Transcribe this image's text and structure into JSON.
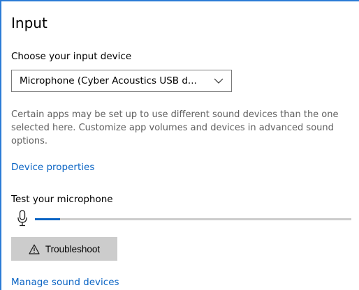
{
  "section": {
    "title": "Input",
    "choose_label": "Choose your input device",
    "device_dropdown": {
      "selected": "Microphone (Cyber Acoustics USB d..."
    },
    "description": "Certain apps may be set up to use different sound devices than the one\nselected here. Customize app volumes and devices in advanced sound\noptions.",
    "device_properties_link": "Device properties",
    "test_label": "Test your microphone",
    "mic_level_percent": 8,
    "troubleshoot_label": "Troubleshoot",
    "manage_link": "Manage sound devices"
  },
  "colors": {
    "accent": "#0a64c4",
    "frame_border": "#2b7bd6",
    "button_bg": "#cccccc",
    "track": "#cccccc",
    "muted_text": "#5f5f5f"
  },
  "icons": {
    "dropdown": "chevron-down-icon",
    "test": "microphone-icon",
    "troubleshoot": "warning-icon"
  }
}
